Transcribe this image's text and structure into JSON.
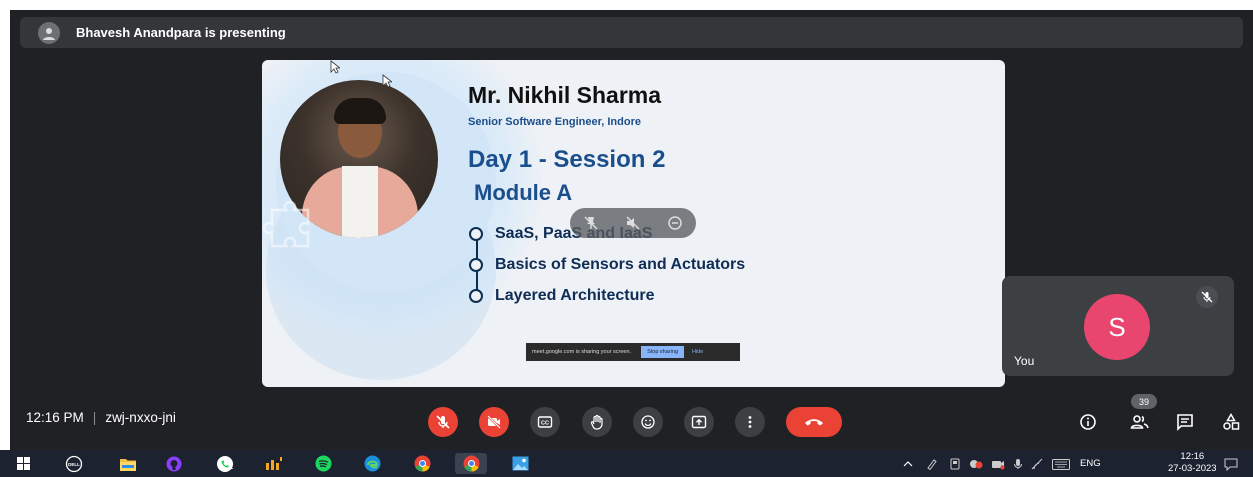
{
  "presenting_bar": {
    "text": "Bhavesh Anandpara is presenting"
  },
  "slide": {
    "name": "Mr. Nikhil Sharma",
    "role": "Senior Software Engineer, Indore",
    "day": "Day 1 - Session 2",
    "module": "Module A",
    "bullets": [
      "SaaS, PaaS and IaaS",
      "Basics of Sensors and Actuators",
      "Layered Architecture"
    ],
    "share_banner": {
      "text": "meet.google.com is sharing your screen.",
      "stop_label": "Stop sharing",
      "hide_label": "Hide"
    }
  },
  "self_tile": {
    "initial": "S",
    "name": "You",
    "avatar_color": "#e8456f"
  },
  "meeting": {
    "time": "12:16 PM",
    "code": "zwj-nxxo-jni",
    "participants_count": "39"
  },
  "controls": [
    {
      "name": "mic-off-icon"
    },
    {
      "name": "camera-off-icon"
    },
    {
      "name": "captions-icon"
    },
    {
      "name": "raise-hand-icon"
    },
    {
      "name": "emoji-icon"
    },
    {
      "name": "present-icon"
    },
    {
      "name": "more-options-icon"
    },
    {
      "name": "hang-up-icon"
    }
  ],
  "right_controls": [
    "info-icon",
    "people-icon",
    "chat-icon",
    "activities-icon"
  ],
  "taskbar": {
    "apps": [
      "windows-start-icon",
      "dell-icon",
      "file-explorer-icon",
      "github-icon",
      "whatsapp-icon",
      "lms-icon",
      "spotify-icon",
      "edge-icon",
      "chrome-icon",
      "chrome-active-icon",
      "photos-icon"
    ],
    "whatsapp_badge": "1",
    "language": "ENG",
    "clock_time": "12:16",
    "clock_date": "27-03-2023"
  },
  "colors": {
    "meet_bg": "#202124",
    "danger": "#ea4335",
    "slide_accent": "#1a4f8c",
    "taskbar_bg": "#1c2230"
  }
}
